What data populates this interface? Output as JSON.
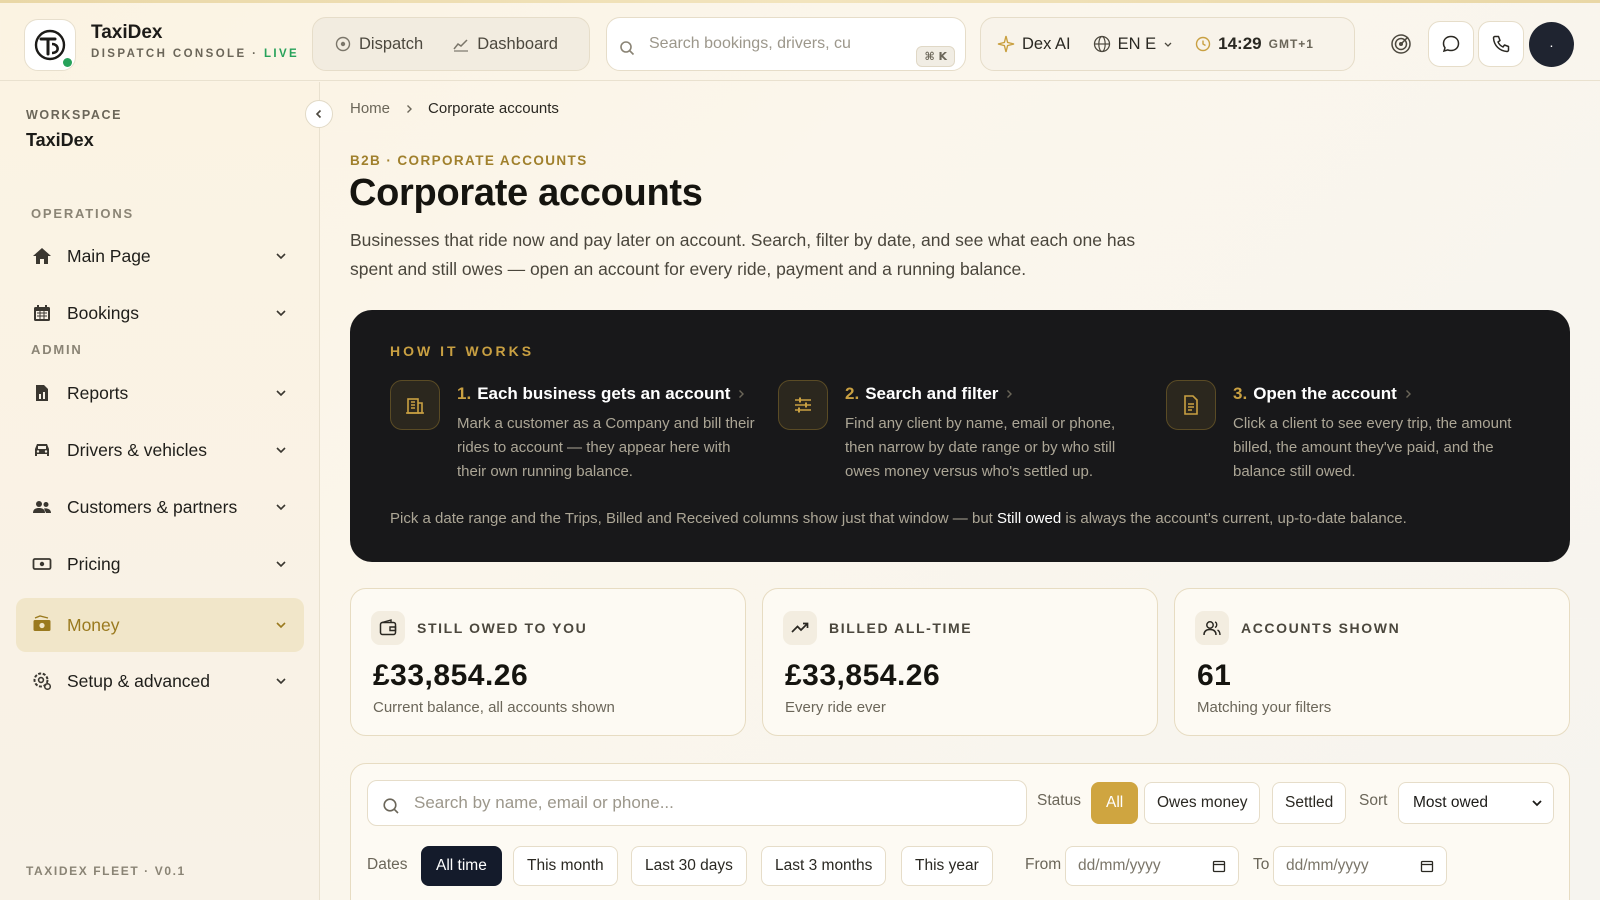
{
  "header": {
    "brand_name": "TaxiDex",
    "brand_sub": "DISPATCH CONSOLE · ",
    "brand_live": "LIVE",
    "nav": [
      {
        "label": "Dispatch",
        "icon": "dispatch-icon"
      },
      {
        "label": "Dashboard",
        "icon": "chart-icon"
      }
    ],
    "search_placeholder": "Search bookings, drivers, cu",
    "search_shortcut": "⌘ K",
    "ai_label": "Dex AI",
    "language": "EN E",
    "time": "14:29",
    "timezone": "GMT+1",
    "avatar_initial": "·"
  },
  "sidebar": {
    "workspace_label": "WORKSPACE",
    "workspace_name": "TaxiDex",
    "sections": {
      "operations": "OPERATIONS",
      "admin": "ADMIN"
    },
    "items": [
      {
        "label": "Main Page",
        "icon": "home-icon"
      },
      {
        "label": "Bookings",
        "icon": "calendar-icon"
      },
      {
        "label": "Reports",
        "icon": "report-icon"
      },
      {
        "label": "Drivers & vehicles",
        "icon": "car-icon"
      },
      {
        "label": "Customers & partners",
        "icon": "users-icon"
      },
      {
        "label": "Pricing",
        "icon": "pricing-icon"
      },
      {
        "label": "Money",
        "icon": "money-icon",
        "active": true
      },
      {
        "label": "Setup & advanced",
        "icon": "settings-icon"
      }
    ],
    "footer": "TAXIDEX FLEET · V0.1"
  },
  "breadcrumb": {
    "home": "Home",
    "current": "Corporate accounts"
  },
  "page": {
    "eyebrow": "B2B · CORPORATE ACCOUNTS",
    "title": "Corporate accounts",
    "description": "Businesses that ride now and pay later on account. Search, filter by date, and see what each one has spent and still owes — open an account for every ride, payment and a running balance."
  },
  "how_it_works": {
    "label": "HOW IT WORKS",
    "steps": [
      {
        "num": "1.",
        "title": "Each business gets an account",
        "text": "Mark a customer as a Company and bill their rides to account — they appear here with their own running balance.",
        "icon": "building-icon"
      },
      {
        "num": "2.",
        "title": "Search and filter",
        "text": "Find any client by name, email or phone, then narrow by date range or by who still owes money versus who's settled up.",
        "icon": "sliders-icon"
      },
      {
        "num": "3.",
        "title": "Open the account",
        "text": "Click a client to see every trip, the amount billed, the amount they've paid, and the balance still owed.",
        "icon": "document-icon"
      }
    ],
    "footer_pre": "Pick a date range and the Trips, Billed and Received columns show just that window — but ",
    "footer_bold": "Still owed",
    "footer_post": " is always the account's current, up-to-date balance."
  },
  "stats": [
    {
      "label": "STILL OWED TO YOU",
      "value": "£33,854.26",
      "sub": "Current balance, all accounts shown",
      "icon": "wallet-icon"
    },
    {
      "label": "BILLED ALL-TIME",
      "value": "£33,854.26",
      "sub": "Every ride ever",
      "icon": "trend-up-icon"
    },
    {
      "label": "ACCOUNTS SHOWN",
      "value": "61",
      "sub": "Matching your filters",
      "icon": "people-icon"
    }
  ],
  "filters": {
    "search_placeholder": "Search by name, email or phone...",
    "status_label": "Status",
    "status_options": [
      "All",
      "Owes money",
      "Settled"
    ],
    "status_selected": "All",
    "sort_label": "Sort",
    "sort_value": "Most owed",
    "dates_label": "Dates",
    "date_options": [
      "All time",
      "This month",
      "Last 30 days",
      "Last 3 months",
      "This year"
    ],
    "date_selected": "All time",
    "from_label": "From",
    "to_label": "To",
    "date_placeholder": "dd/mm/yyyy"
  }
}
